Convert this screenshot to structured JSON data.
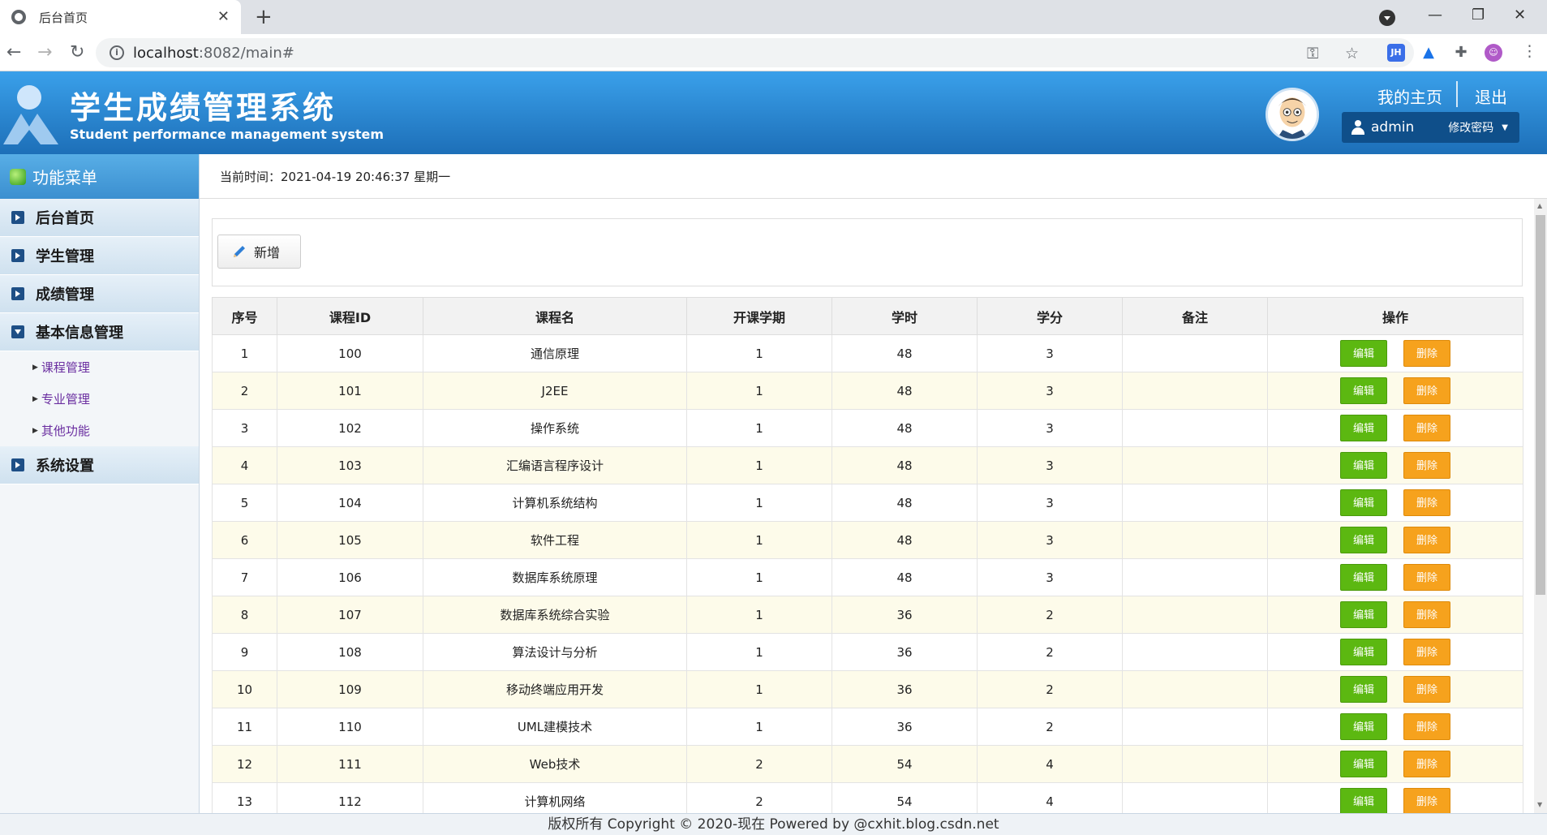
{
  "browser": {
    "tab_title": "后台首页",
    "url_host": "localhost",
    "url_rest": ":8082/main#",
    "ext_jh": "JH"
  },
  "header": {
    "title": "学生成绩管理系统",
    "subtitle": "Student performance management system",
    "home_link": "我的主页",
    "logout_link": "退出",
    "username": "admin",
    "change_password": "修改密码"
  },
  "sidebar": {
    "title": "功能菜单",
    "items": [
      {
        "label": "后台首页"
      },
      {
        "label": "学生管理"
      },
      {
        "label": "成绩管理"
      },
      {
        "label": "基本信息管理"
      },
      {
        "label": "系统设置"
      }
    ],
    "subitems": [
      {
        "label": "课程管理"
      },
      {
        "label": "专业管理"
      },
      {
        "label": "其他功能"
      }
    ]
  },
  "time_bar": {
    "label": "当前时间：",
    "value": "2021-04-19 20:46:37 星期一"
  },
  "toolbar": {
    "add_label": "新增"
  },
  "table": {
    "columns": [
      "序号",
      "课程ID",
      "课程名",
      "开课学期",
      "学时",
      "学分",
      "备注",
      "操作"
    ],
    "edit_label": "编辑",
    "delete_label": "删除",
    "rows": [
      {
        "no": "1",
        "id": "100",
        "name": "通信原理",
        "term": "1",
        "hours": "48",
        "credit": "3",
        "note": ""
      },
      {
        "no": "2",
        "id": "101",
        "name": "J2EE",
        "term": "1",
        "hours": "48",
        "credit": "3",
        "note": ""
      },
      {
        "no": "3",
        "id": "102",
        "name": "操作系统",
        "term": "1",
        "hours": "48",
        "credit": "3",
        "note": ""
      },
      {
        "no": "4",
        "id": "103",
        "name": "汇编语言程序设计",
        "term": "1",
        "hours": "48",
        "credit": "3",
        "note": ""
      },
      {
        "no": "5",
        "id": "104",
        "name": "计算机系统结构",
        "term": "1",
        "hours": "48",
        "credit": "3",
        "note": ""
      },
      {
        "no": "6",
        "id": "105",
        "name": "软件工程",
        "term": "1",
        "hours": "48",
        "credit": "3",
        "note": ""
      },
      {
        "no": "7",
        "id": "106",
        "name": "数据库系统原理",
        "term": "1",
        "hours": "48",
        "credit": "3",
        "note": ""
      },
      {
        "no": "8",
        "id": "107",
        "name": "数据库系统综合实验",
        "term": "1",
        "hours": "36",
        "credit": "2",
        "note": ""
      },
      {
        "no": "9",
        "id": "108",
        "name": "算法设计与分析",
        "term": "1",
        "hours": "36",
        "credit": "2",
        "note": ""
      },
      {
        "no": "10",
        "id": "109",
        "name": "移动终端应用开发",
        "term": "1",
        "hours": "36",
        "credit": "2",
        "note": ""
      },
      {
        "no": "11",
        "id": "110",
        "name": "UML建模技术",
        "term": "1",
        "hours": "36",
        "credit": "2",
        "note": ""
      },
      {
        "no": "12",
        "id": "111",
        "name": "Web技术",
        "term": "2",
        "hours": "54",
        "credit": "4",
        "note": ""
      },
      {
        "no": "13",
        "id": "112",
        "name": "计算机网络",
        "term": "2",
        "hours": "54",
        "credit": "4",
        "note": ""
      }
    ]
  },
  "footer": {
    "text": "版权所有 Copyright © 2020-现在 Powered by @cxhit.blog.csdn.net"
  }
}
